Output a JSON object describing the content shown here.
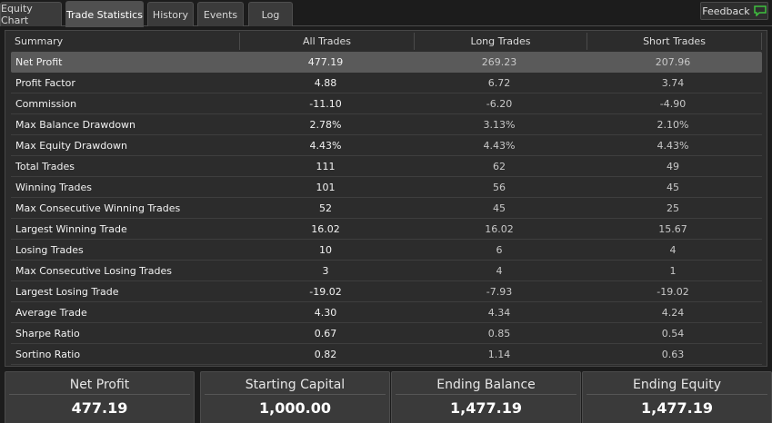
{
  "tabs": [
    {
      "label": "Equity Chart"
    },
    {
      "label": "Trade Statistics"
    },
    {
      "label": "History"
    },
    {
      "label": "Events"
    },
    {
      "label": "Log"
    }
  ],
  "feedback": {
    "label": "Feedback"
  },
  "table": {
    "headers": [
      "Summary",
      "All Trades",
      "Long Trades",
      "Short Trades"
    ],
    "rows": [
      {
        "label": "Net Profit",
        "all": "477.19",
        "long": "269.23",
        "short": "207.96"
      },
      {
        "label": "Profit Factor",
        "all": "4.88",
        "long": "6.72",
        "short": "3.74"
      },
      {
        "label": "Commission",
        "all": "-11.10",
        "long": "-6.20",
        "short": "-4.90"
      },
      {
        "label": "Max Balance Drawdown",
        "all": "2.78%",
        "long": "3.13%",
        "short": "2.10%"
      },
      {
        "label": "Max Equity Drawdown",
        "all": "4.43%",
        "long": "4.43%",
        "short": "4.43%"
      },
      {
        "label": "Total Trades",
        "all": "111",
        "long": "62",
        "short": "49"
      },
      {
        "label": "Winning Trades",
        "all": "101",
        "long": "56",
        "short": "45"
      },
      {
        "label": "Max Consecutive Winning Trades",
        "all": "52",
        "long": "45",
        "short": "25"
      },
      {
        "label": "Largest Winning Trade",
        "all": "16.02",
        "long": "16.02",
        "short": "15.67"
      },
      {
        "label": "Losing Trades",
        "all": "10",
        "long": "6",
        "short": "4"
      },
      {
        "label": "Max Consecutive Losing Trades",
        "all": "3",
        "long": "4",
        "short": "1"
      },
      {
        "label": "Largest Losing Trade",
        "all": "-19.02",
        "long": "-7.93",
        "short": "-19.02"
      },
      {
        "label": "Average Trade",
        "all": "4.30",
        "long": "4.34",
        "short": "4.24"
      },
      {
        "label": "Sharpe Ratio",
        "all": "0.67",
        "long": "0.85",
        "short": "0.54"
      },
      {
        "label": "Sortino Ratio",
        "all": "0.82",
        "long": "1.14",
        "short": "0.63"
      }
    ]
  },
  "cards": [
    {
      "title": "Net Profit",
      "value": "477.19"
    },
    {
      "title": "Starting Capital",
      "value": "1,000.00"
    },
    {
      "title": "Ending Balance",
      "value": "1,477.19"
    },
    {
      "title": "Ending Equity",
      "value": "1,477.19"
    }
  ],
  "colors": {
    "background": "#1c1c1c",
    "panel": "#2c2c2c",
    "selected_row": "#5a5a5a",
    "feedback_icon": "#3fbf3f"
  }
}
